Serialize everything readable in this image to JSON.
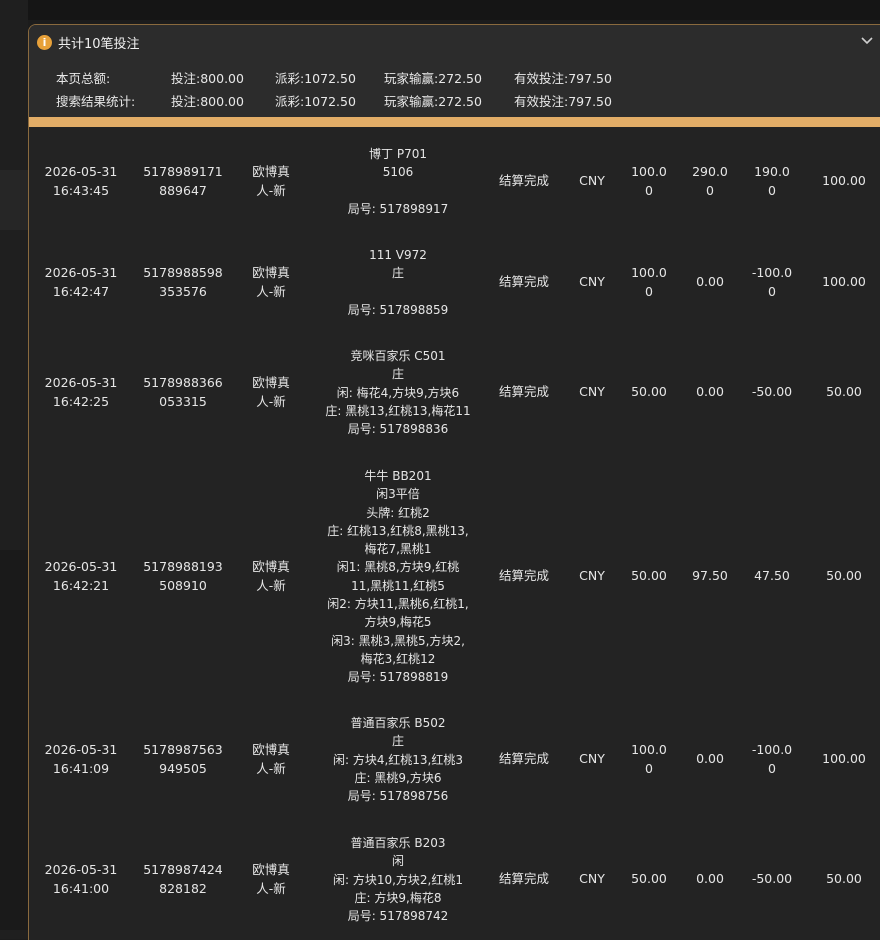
{
  "header": {
    "info_icon": "info-icon",
    "title": "共计10笔投注",
    "collapse_icon": "chevron-down-icon"
  },
  "summary": {
    "page_total": {
      "label": "本页总额:",
      "bet": "投注:800.00",
      "payout": "派彩:1072.50",
      "player_winloss": "玩家输赢:272.50",
      "valid_bet": "有效投注:797.50"
    },
    "search_total": {
      "label": "搜索结果统计:",
      "bet": "投注:800.00",
      "payout": "派彩:1072.50",
      "player_winloss": "玩家输赢:272.50",
      "valid_bet": "有效投注:797.50"
    }
  },
  "colors": {
    "accent_bar": "#e2ad67",
    "info_icon": "#e7a13a",
    "panel_bg": "#232323",
    "header_bg": "#2c2c2c"
  },
  "records": [
    {
      "date": "2026-05-31",
      "time": "16:43:45",
      "order_1": "5178989171",
      "order_2": "889647",
      "platform_1": "欧博真",
      "platform_2": "人-新",
      "detail": [
        "博丁 P701",
        "5106",
        "",
        "局号: 517898917"
      ],
      "status": "结算完成",
      "currency": "CNY",
      "bet_1": "100.0",
      "bet_2": "0",
      "payout_1": "290.0",
      "payout_2": "0",
      "winloss_1": "190.0",
      "winloss_2": "0",
      "valid_bet": "100.00"
    },
    {
      "date": "2026-05-31",
      "time": "16:42:47",
      "order_1": "5178988598",
      "order_2": "353576",
      "platform_1": "欧博真",
      "platform_2": "人-新",
      "detail": [
        "111 V972",
        "庄",
        "",
        "局号: 517898859"
      ],
      "status": "结算完成",
      "currency": "CNY",
      "bet_1": "100.0",
      "bet_2": "0",
      "payout_1": "0.00",
      "payout_2": "",
      "winloss_1": "-100.0",
      "winloss_2": "0",
      "valid_bet": "100.00"
    },
    {
      "date": "2026-05-31",
      "time": "16:42:25",
      "order_1": "5178988366",
      "order_2": "053315",
      "platform_1": "欧博真",
      "platform_2": "人-新",
      "detail": [
        "竞咪百家乐 C501",
        "庄",
        "闲: 梅花4,方块9,方块6",
        "庄: 黑桃13,红桃13,梅花11",
        "局号: 517898836"
      ],
      "status": "结算完成",
      "currency": "CNY",
      "bet_1": "50.00",
      "bet_2": "",
      "payout_1": "0.00",
      "payout_2": "",
      "winloss_1": "-50.00",
      "winloss_2": "",
      "valid_bet": "50.00"
    },
    {
      "date": "2026-05-31",
      "time": "16:42:21",
      "order_1": "5178988193",
      "order_2": "508910",
      "platform_1": "欧博真",
      "platform_2": "人-新",
      "detail": [
        "牛牛 BB201",
        "闲3平倍",
        "头牌: 红桃2",
        "庄: 红桃13,红桃8,黑桃13,",
        "梅花7,黑桃1",
        "闲1: 黑桃8,方块9,红桃",
        "11,黑桃11,红桃5",
        "闲2: 方块11,黑桃6,红桃1,",
        "方块9,梅花5",
        "闲3: 黑桃3,黑桃5,方块2,",
        "梅花3,红桃12",
        "局号: 517898819"
      ],
      "status": "结算完成",
      "currency": "CNY",
      "bet_1": "50.00",
      "bet_2": "",
      "payout_1": "97.50",
      "payout_2": "",
      "winloss_1": "47.50",
      "winloss_2": "",
      "valid_bet": "50.00"
    },
    {
      "date": "2026-05-31",
      "time": "16:41:09",
      "order_1": "5178987563",
      "order_2": "949505",
      "platform_1": "欧博真",
      "platform_2": "人-新",
      "detail": [
        "普通百家乐 B502",
        "庄",
        "闲: 方块4,红桃13,红桃3",
        "庄: 黑桃9,方块6",
        "局号: 517898756"
      ],
      "status": "结算完成",
      "currency": "CNY",
      "bet_1": "100.0",
      "bet_2": "0",
      "payout_1": "0.00",
      "payout_2": "",
      "winloss_1": "-100.0",
      "winloss_2": "0",
      "valid_bet": "100.00"
    },
    {
      "date": "2026-05-31",
      "time": "16:41:00",
      "order_1": "5178987424",
      "order_2": "828182",
      "platform_1": "欧博真",
      "platform_2": "人-新",
      "detail": [
        "普通百家乐 B203",
        "闲",
        "闲: 方块10,方块2,红桃1",
        "庄: 方块9,梅花8",
        "局号: 517898742"
      ],
      "status": "结算完成",
      "currency": "CNY",
      "bet_1": "50.00",
      "bet_2": "",
      "payout_1": "0.00",
      "payout_2": "",
      "winloss_1": "-50.00",
      "winloss_2": "",
      "valid_bet": "50.00"
    }
  ]
}
